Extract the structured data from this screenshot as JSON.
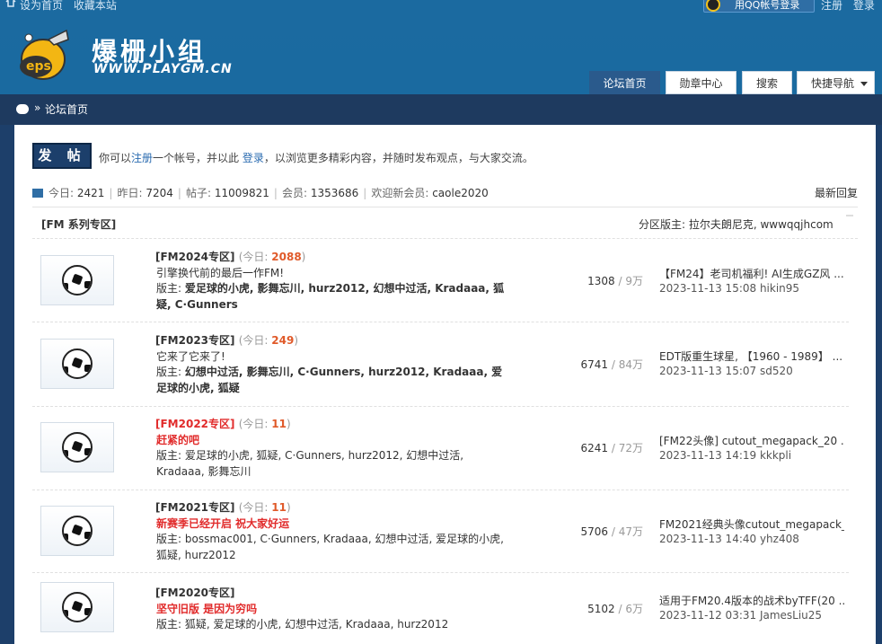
{
  "topbar": {
    "set_home": "设为首页",
    "bookmark": "收藏本站",
    "qq_login": "用QQ帐号登录",
    "register": "注册",
    "login": "登录"
  },
  "header": {
    "logo_badge": "eps",
    "site_name": "爆栅小组",
    "site_url": "WWW.PLAYGM.CN"
  },
  "nav": {
    "items": [
      "论坛首页",
      "勋章中心",
      "搜索",
      "快捷导航"
    ]
  },
  "breadcrumb": {
    "sep": "»",
    "current": "论坛首页"
  },
  "main": {
    "post_button": "发 帖",
    "notice_1": "你可以",
    "notice_register": "注册",
    "notice_2": "一个帐号，并以此",
    "notice_login": "登录",
    "notice_3": "，以浏览更多精彩内容，并随时发布观点，与大家交流。",
    "stats": {
      "today_label": "今日:",
      "today": "2421",
      "yesterday_label": "昨日:",
      "yesterday": "7204",
      "posts_label": "帖子:",
      "posts": "11009821",
      "members_label": "会员:",
      "members": "1353686",
      "welcome_label": "欢迎新会员:",
      "welcome": "caole2020"
    },
    "latest_reply": "最新回复",
    "section": {
      "title": "[FM 系列专区]",
      "moderators": "分区版主: 拉尔夫朗尼克, wwwqqjhcom"
    },
    "forums": [
      {
        "name": "[FM2024专区]",
        "today_label": "(今日:",
        "today_count": "2088",
        "today_close": ")",
        "desc": "引擎换代前的最后一作FM!",
        "mods_label": "版主:",
        "mods": "爱足球的小虎, 影舞忘川, hurz2012, 幻想中过活, Kradaaa, 狐疑, C·Gunners",
        "threads": "1308",
        "posts": "9万",
        "last_title": "【FM24】老司机福利! AI生成GZ风 ...",
        "last_info": "2023-11-13 15:08 hikin95"
      },
      {
        "name": "[FM2023专区]",
        "today_label": "(今日:",
        "today_count": "249",
        "today_close": ")",
        "desc": "它来了它来了!",
        "mods_label": "版主:",
        "mods": "幻想中过活, 影舞忘川, C·Gunners, hurz2012, Kradaaa, 爱足球的小虎, 狐疑",
        "threads": "6741",
        "posts": "84万",
        "last_title": "EDT版重生球星, 【1960 - 1989】 ...",
        "last_info": "2023-11-13 15:07 sd520"
      },
      {
        "name": "[FM2022专区]",
        "today_label": "(今日:",
        "today_count": "11",
        "today_close": ")",
        "desc": "赶紧的吧",
        "mods_label": "版主:",
        "mods": "爱足球的小虎, 狐疑, C·Gunners, hurz2012, 幻想中过活, Kradaaa, 影舞忘川",
        "threads": "6241",
        "posts": "72万",
        "last_title": "[FM22头像] cutout_megapack_20 ...",
        "last_info": "2023-11-13 14:19 kkkpli"
      },
      {
        "name": "[FM2021专区]",
        "today_label": "(今日:",
        "today_count": "11",
        "today_close": ")",
        "desc": "新赛季已经开启 祝大家好运",
        "mods_label": "版主:",
        "mods": "bossmac001, C·Gunners, Kradaaa, 幻想中过活, 爱足球的小虎, 狐疑, hurz2012",
        "threads": "5706",
        "posts": "47万",
        "last_title": "FM2021经典头像cutout_megapack_ ...",
        "last_info": "2023-11-13 14:40 yhz408"
      },
      {
        "name": "[FM2020专区]",
        "today_label": "",
        "today_count": "",
        "today_close": "",
        "desc": "坚守旧版 是因为穷吗",
        "mods_label": "版主:",
        "mods": "狐疑, 爱足球的小虎, 幻想中过活, Kradaaa, hurz2012",
        "threads": "5102",
        "posts": "6万",
        "last_title": "适用于FM20.4版本的战术byTFF(20 ...",
        "last_info": "2023-11-12 03:31 JamesLiu25"
      }
    ]
  }
}
